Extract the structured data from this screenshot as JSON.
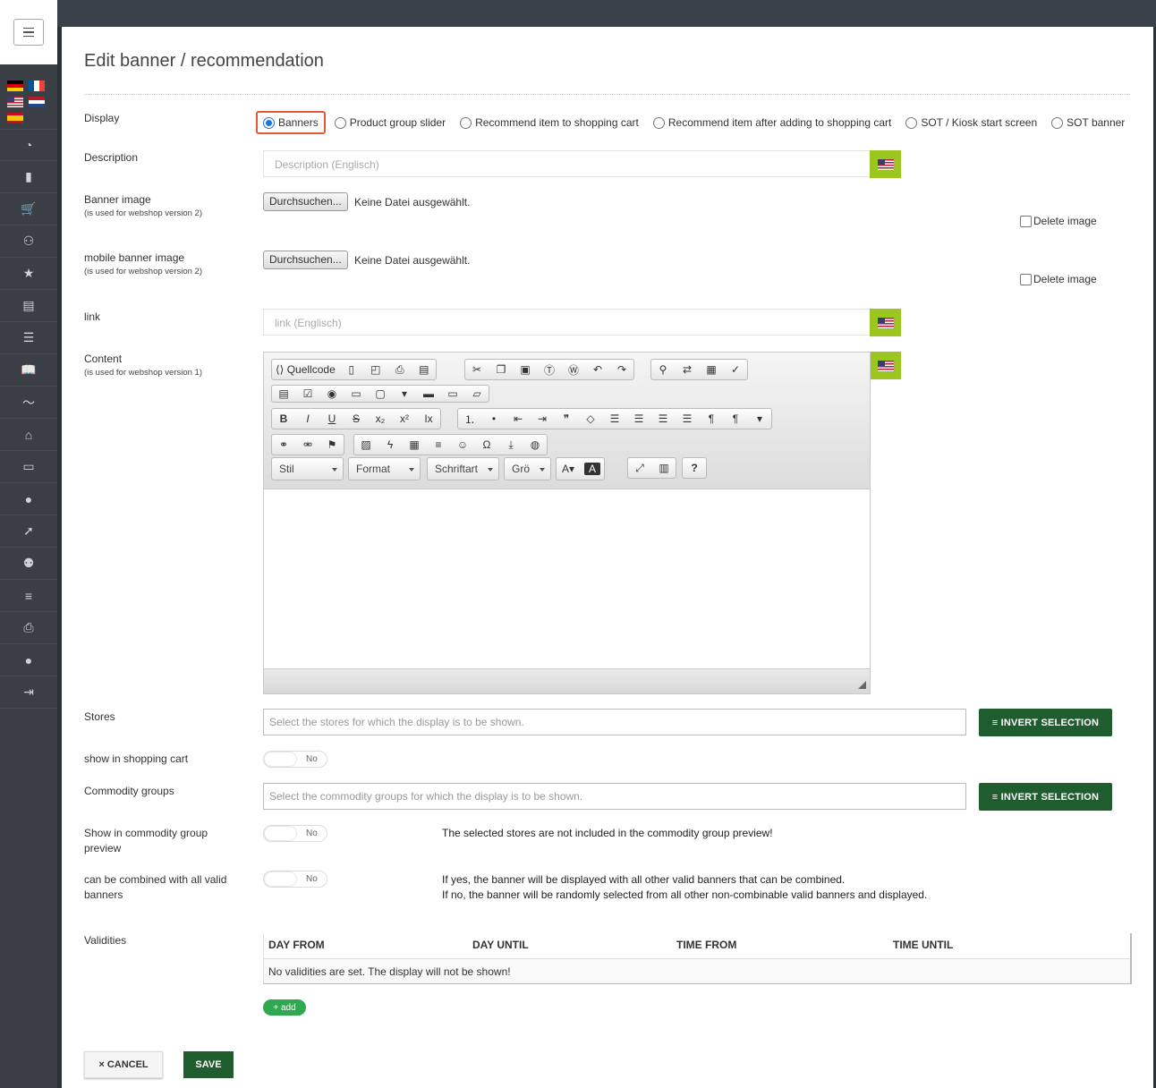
{
  "page": {
    "title": "Edit banner / recommendation"
  },
  "sidebar": {
    "icons": [
      "dashboard-icon",
      "bar-chart-icon",
      "cart-icon",
      "add-user-icon",
      "star-icon",
      "archive-icon",
      "list-icon",
      "book-icon",
      "trend-icon",
      "home-icon",
      "monitor-icon",
      "user-icon",
      "rocket-icon",
      "users-icon",
      "database-icon",
      "printer-icon",
      "profile-icon",
      "logout-icon"
    ],
    "glyphs": [
      "◔",
      "▮",
      "🛒",
      "⚇",
      "★",
      "▤",
      "☰",
      "📖",
      "〜",
      "⌂",
      "▭",
      "●",
      "➚",
      "⚉",
      "≡",
      "⎙",
      "●",
      "⇥"
    ]
  },
  "form": {
    "display": {
      "label": "Display",
      "options": [
        "Banners",
        "Product group slider",
        "Recommend item to shopping cart",
        "Recommend item after adding to shopping cart",
        "SOT / Kiosk start screen",
        "SOT banner"
      ],
      "selected": "Banners"
    },
    "description": {
      "label": "Description",
      "placeholder": "Description (Englisch)"
    },
    "banner_image": {
      "label": "Banner image",
      "hint": "(is used for webshop version 2)",
      "button": "Durchsuchen...",
      "status": "Keine Datei ausgewählt.",
      "delete": "Delete image"
    },
    "mobile_banner_image": {
      "label": "mobile banner image",
      "hint": "(is used for webshop version 2)",
      "button": "Durchsuchen...",
      "status": "Keine Datei ausgewählt.",
      "delete": "Delete image"
    },
    "link": {
      "label": "link",
      "placeholder": "link (Englisch)"
    },
    "content": {
      "label": "Content",
      "hint": "(is used for webshop version 1)"
    },
    "stores": {
      "label": "Stores",
      "placeholder": "Select the stores for which the display is to be shown.",
      "button": "≡ INVERT SELECTION"
    },
    "show_in_cart": {
      "label": "show in shopping cart",
      "value": "No"
    },
    "commodity_groups": {
      "label": "Commodity groups",
      "placeholder": "Select the commodity groups for which the display is to be shown.",
      "button": "≡ INVERT SELECTION"
    },
    "show_in_preview": {
      "label": "Show in commodity group preview",
      "value": "No",
      "note": "The selected stores are not included in the commodity group preview!"
    },
    "combinable": {
      "label": "can be combined with all valid banners",
      "value": "No",
      "note1": "If yes, the banner will be displayed with all other valid banners that can be combined.",
      "note2": "If no, the banner will be randomly selected from all other non-combinable valid banners and displayed."
    },
    "validities": {
      "label": "Validities",
      "columns": [
        "DAY FROM",
        "DAY UNTIL",
        "TIME FROM",
        "TIME UNTIL"
      ],
      "empty": "No validities are set. The display will not be shown!",
      "add": "+ add"
    }
  },
  "editor": {
    "source_label": "Quellcode",
    "combos": [
      "Stil",
      "Format",
      "Schriftart",
      "Grö"
    ],
    "help": "?"
  },
  "actions": {
    "cancel": "× CANCEL",
    "save": "SAVE"
  }
}
